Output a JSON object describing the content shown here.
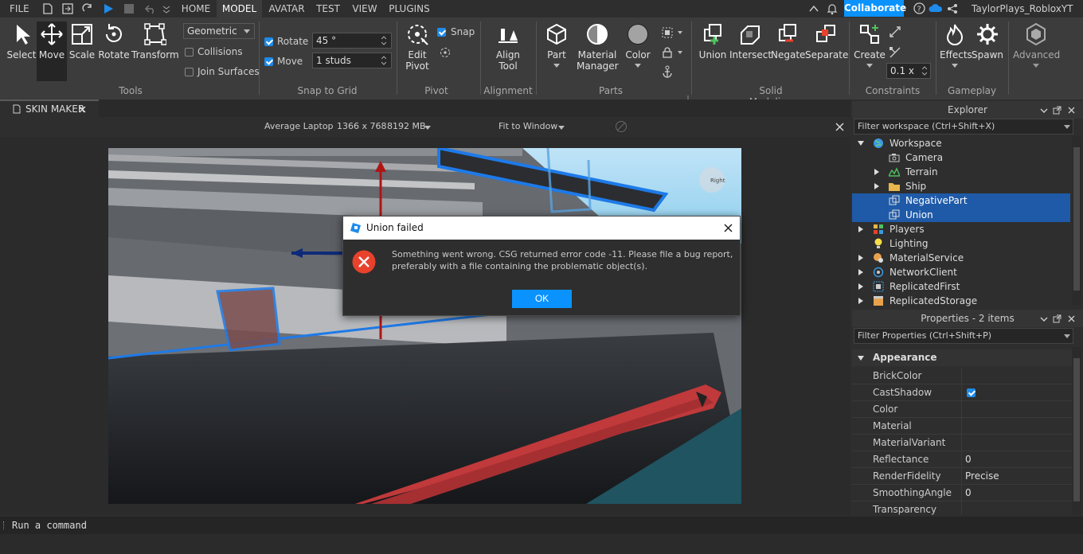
{
  "menubar": {
    "file": "FILE",
    "tabs": [
      "HOME",
      "MODEL",
      "AVATAR",
      "TEST",
      "VIEW",
      "PLUGINS"
    ],
    "active_tab": "MODEL",
    "collaborate": "Collaborate",
    "username": "TaylorPlays_RobloxYT"
  },
  "ribbon": {
    "tools": {
      "select": "Select",
      "move": "Move",
      "scale": "Scale",
      "rotate": "Rotate",
      "transform": "Transform",
      "group": "Tools"
    },
    "geometric": {
      "mode": "Geometric",
      "collisions": "Collisions",
      "join_surfaces": "Join Surfaces"
    },
    "snap": {
      "rotate_label": "Rotate",
      "rotate_value": "45 °",
      "move_label": "Move",
      "move_value": "1 studs",
      "group": "Snap to Grid"
    },
    "pivot": {
      "edit": "Edit",
      "pivot": "Pivot",
      "snap": "Snap",
      "group": "Pivot"
    },
    "alignment": {
      "align": "Align",
      "tool": "Tool",
      "group": "Alignment"
    },
    "parts": {
      "part": "Part",
      "material": "Material",
      "manager": "Manager",
      "color": "Color",
      "group": "Parts"
    },
    "solid": {
      "union": "Union",
      "intersect": "Intersect",
      "negate": "Negate",
      "separate": "Separate",
      "group": "Solid Modeling"
    },
    "constraints": {
      "create": "Create",
      "value": "0.1 x",
      "group": "Constraints"
    },
    "gameplay": {
      "effects": "Effects",
      "spawn": "Spawn",
      "group": "Gameplay"
    },
    "advanced": {
      "label": "Advanced"
    }
  },
  "doc_tab": {
    "title": "SKIN MAKER"
  },
  "emulation": {
    "device": "Average Laptop",
    "resolution": "1366 x 768",
    "memory": "8192 MB",
    "fit": "Fit to Window"
  },
  "explorer": {
    "title": "Explorer",
    "filter": "Filter workspace (Ctrl+Shift+X)",
    "items": [
      {
        "label": "Workspace"
      },
      {
        "label": "Camera"
      },
      {
        "label": "Terrain"
      },
      {
        "label": "Ship"
      },
      {
        "label": "NegativePart"
      },
      {
        "label": "Union"
      },
      {
        "label": "Players"
      },
      {
        "label": "Lighting"
      },
      {
        "label": "MaterialService"
      },
      {
        "label": "NetworkClient"
      },
      {
        "label": "ReplicatedFirst"
      },
      {
        "label": "ReplicatedStorage"
      }
    ]
  },
  "properties": {
    "title": "Properties - 2 items",
    "filter": "Filter Properties (Ctrl+Shift+P)",
    "section": "Appearance",
    "rows": [
      {
        "name": "BrickColor",
        "value": ""
      },
      {
        "name": "CastShadow",
        "value": ""
      },
      {
        "name": "Color",
        "value": ""
      },
      {
        "name": "Material",
        "value": ""
      },
      {
        "name": "MaterialVariant",
        "value": ""
      },
      {
        "name": "Reflectance",
        "value": "0"
      },
      {
        "name": "RenderFidelity",
        "value": "Precise"
      },
      {
        "name": "SmoothingAngle",
        "value": "0"
      },
      {
        "name": "Transparency",
        "value": ""
      }
    ]
  },
  "dialog": {
    "title": "Union failed",
    "message_line1": "Something went wrong. CSG returned error code -11. Please file a bug report,",
    "message_line2": "preferably with a file containing the problematic object(s).",
    "ok": "OK"
  },
  "viewport": {
    "orient_label": "Right"
  },
  "command": {
    "placeholder": "Run a command"
  },
  "colors": {
    "accent": "#0a93ff",
    "selection": "#1f5aa8",
    "error": "#e8412c"
  }
}
